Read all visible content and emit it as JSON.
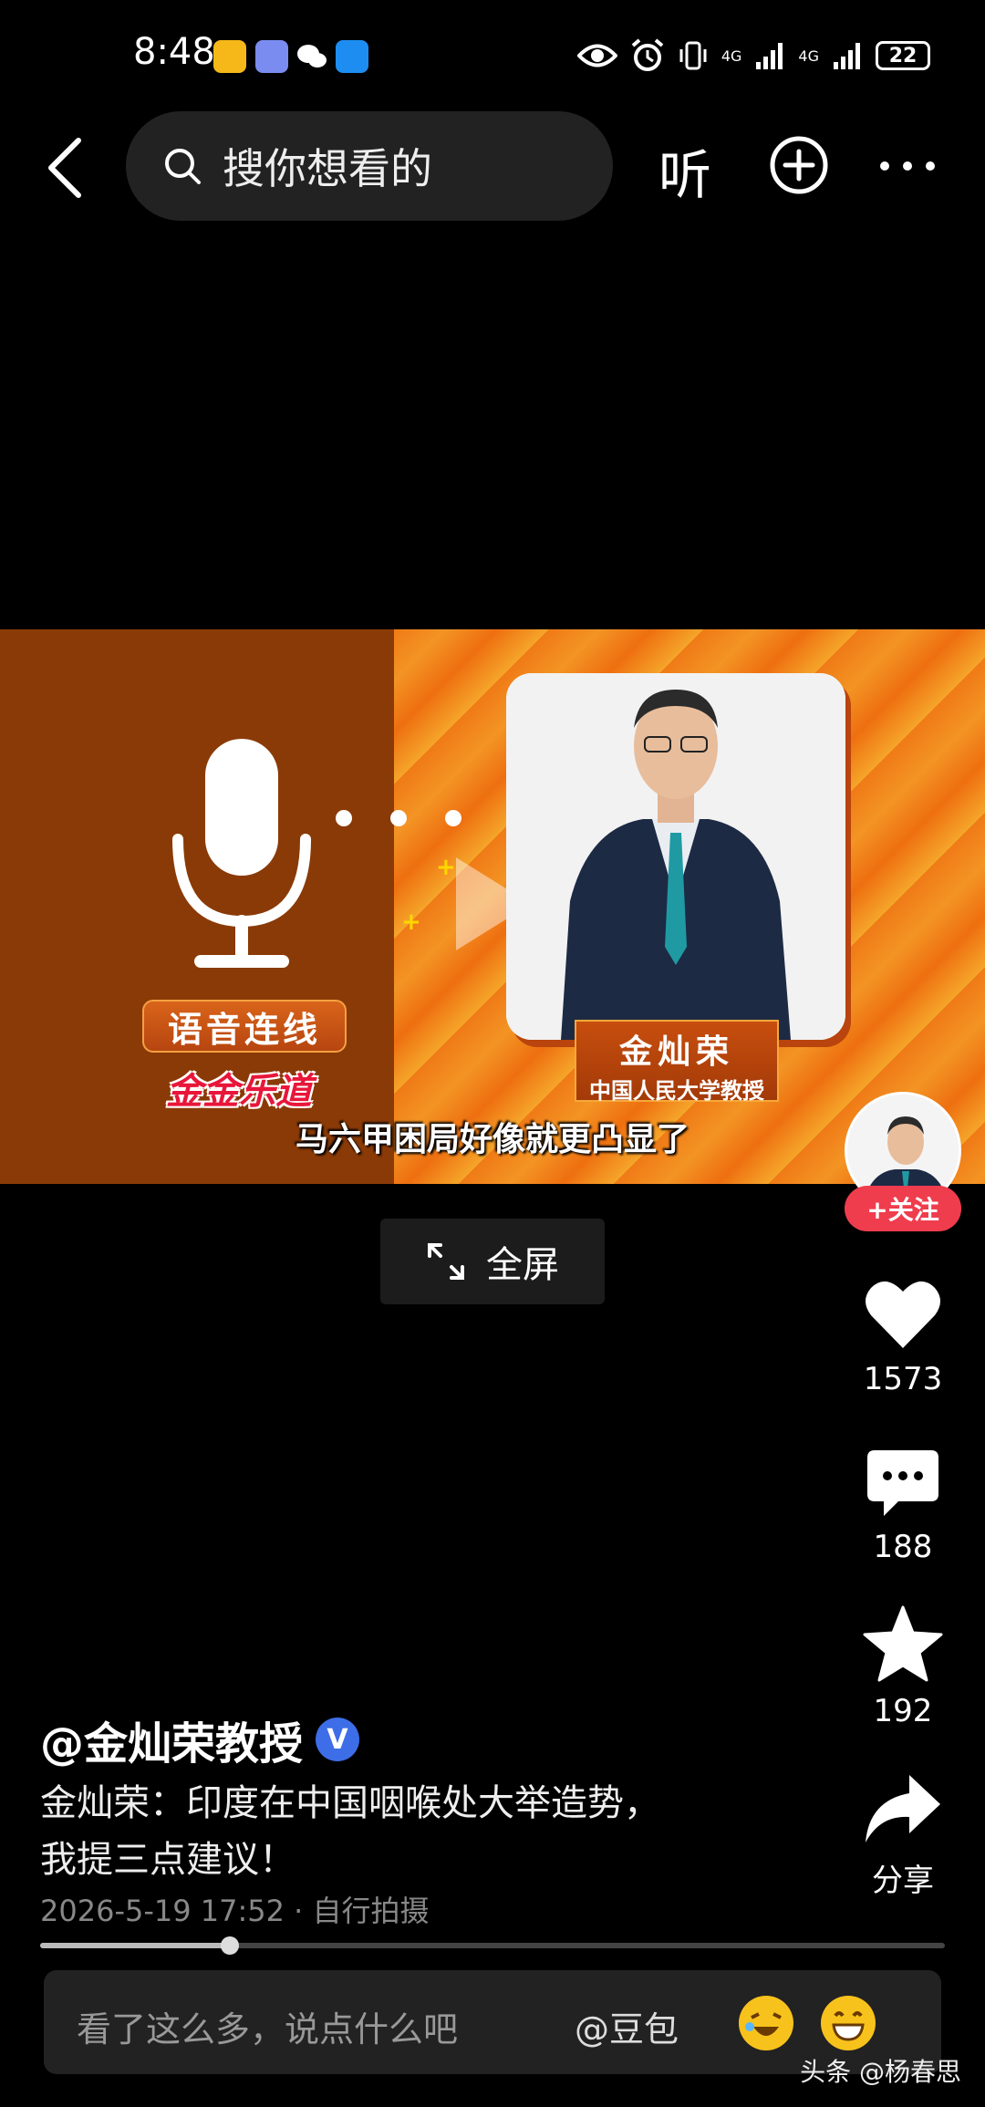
{
  "status_bar": {
    "time": "8:48",
    "network_1": "4G",
    "network_2": "4G",
    "battery": "22"
  },
  "top_nav": {
    "search_placeholder": "搜你想看的",
    "listen_label": "听"
  },
  "video": {
    "voice_tag": "语音连线",
    "brand_logo": "金金乐道",
    "guest_name": "金灿荣",
    "guest_title": "中国人民大学教授",
    "subtitle": "马六甲困局好像就更凸显了"
  },
  "fullscreen_label": "全屏",
  "rail": {
    "follow_label": "+关注",
    "likes": "1573",
    "comments": "188",
    "favorites": "192",
    "share_label": "分享"
  },
  "post": {
    "author": "@金灿荣教授",
    "verified_mark": "V",
    "caption_line1": "金灿荣：印度在中国咽喉处大举造势，",
    "caption_line2": "我提三点建议！",
    "meta": "2026-5-19 17:52 · 自行拍摄",
    "progress": 0.21
  },
  "comment_bar": {
    "placeholder": "看了这么多，说点什么吧",
    "at_label": "@豆包"
  },
  "watermark": "头条 @杨春思",
  "colors": {
    "follow_red": "#ef3d4e",
    "verified_blue": "#3d6ee8",
    "video_orange": "#f07a16"
  }
}
